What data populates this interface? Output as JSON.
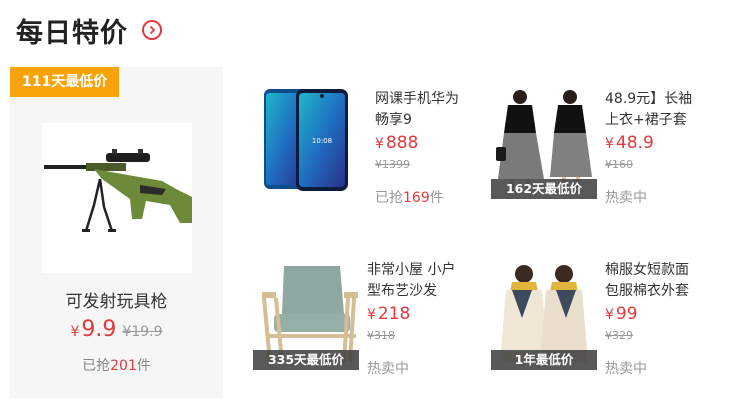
{
  "header": {
    "title": "每日特价",
    "more_icon": "chevron-right-circle-icon",
    "accent": "#e4393c"
  },
  "feature": {
    "badge": "111天最低价",
    "name": "可发射玩具枪",
    "currency": "¥",
    "price": "9.9",
    "original_price": "¥19.9",
    "sold_prefix": "已抢",
    "sold_count": "201",
    "sold_suffix": "件"
  },
  "cards": [
    {
      "name": "网课手机华为畅享9",
      "currency": "¥",
      "price": "888",
      "original_price": "¥1399",
      "status_prefix": "已抢",
      "status_count": "169",
      "status_suffix": "件",
      "badge": ""
    },
    {
      "name": "48.9元】长袖上衣+裙子套",
      "currency": "¥",
      "price": "48.9",
      "original_price": "¥160",
      "status": "热卖中",
      "badge": "162天最低价"
    },
    {
      "name": "非常小屋 小户型布艺沙发",
      "currency": "¥",
      "price": "218",
      "original_price": "¥318",
      "status": "热卖中",
      "badge": "335天最低价"
    },
    {
      "name": "棉服女短款面包服棉衣外套",
      "currency": "¥",
      "price": "99",
      "original_price": "¥329",
      "status": "热卖中",
      "badge": "1年最低价"
    }
  ]
}
